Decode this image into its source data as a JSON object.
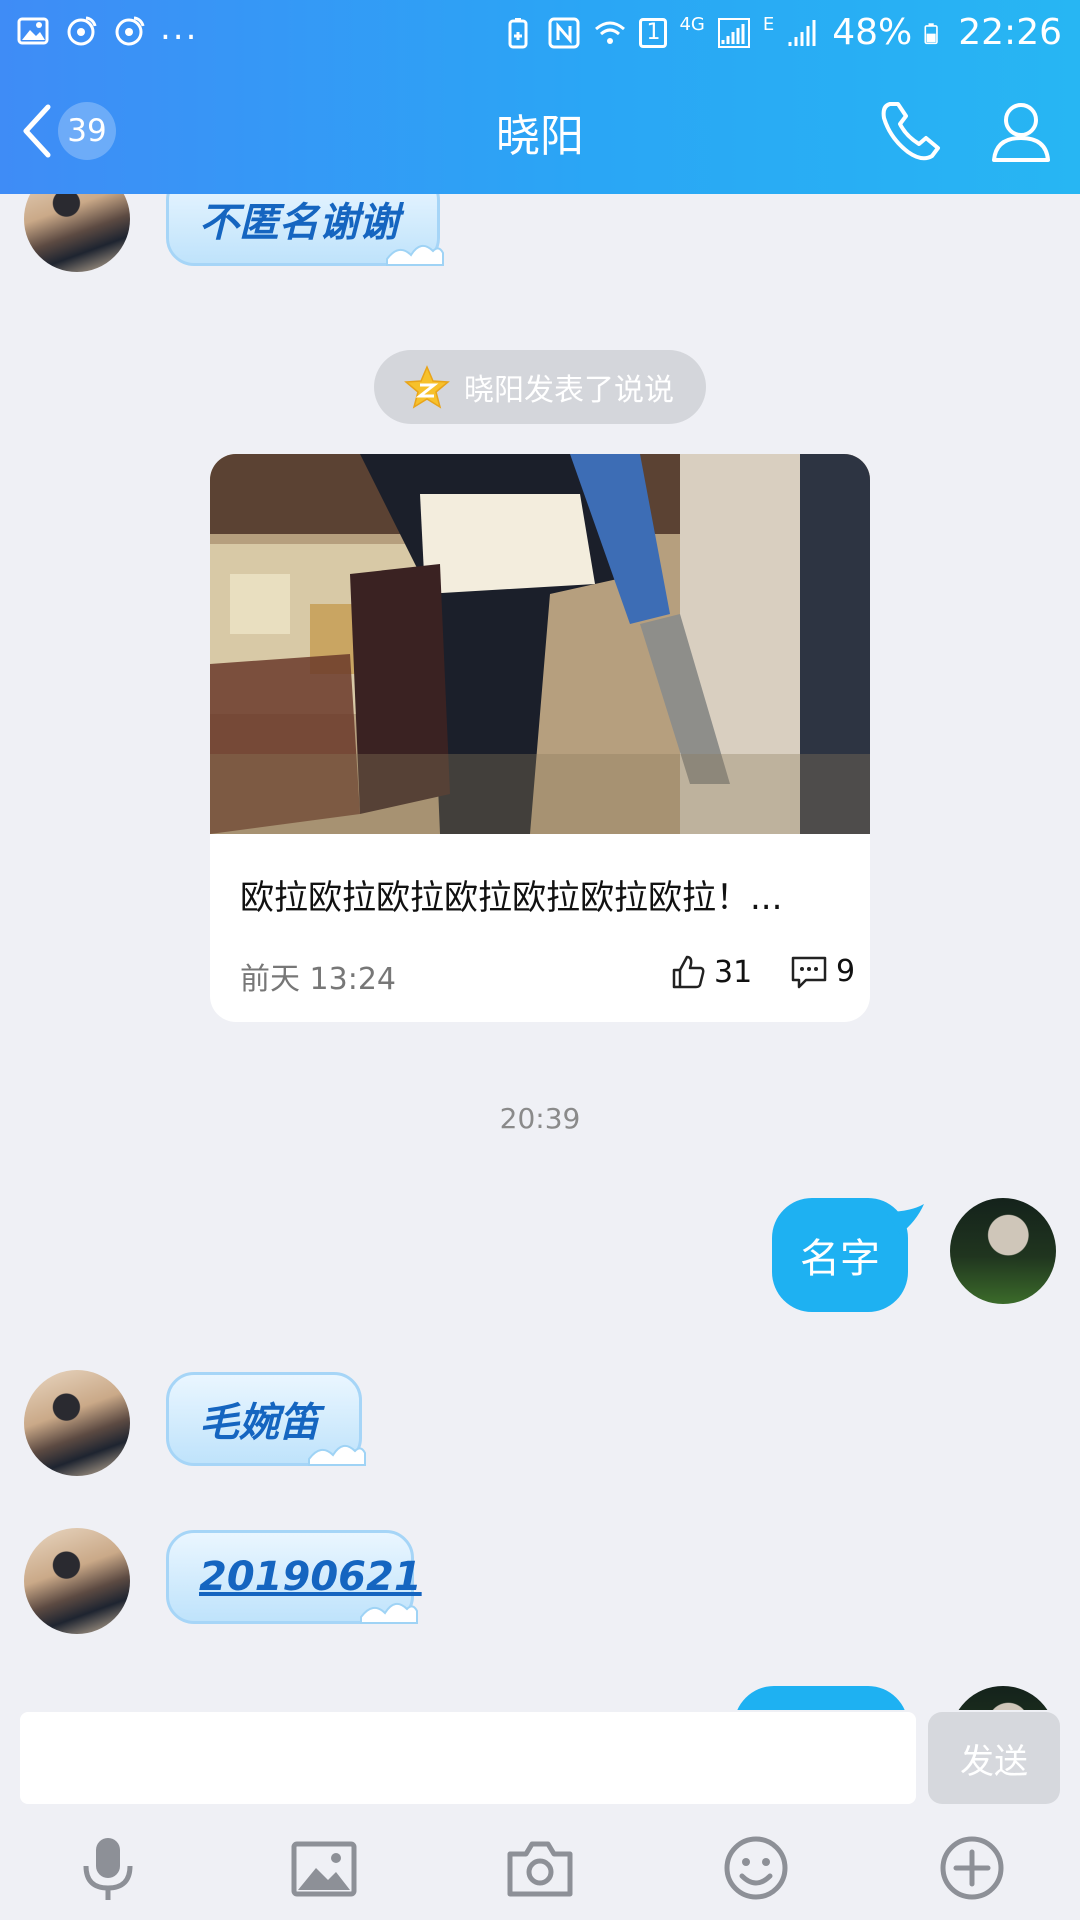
{
  "status_bar": {
    "battery": "48%",
    "time": "22:26",
    "sim_badge": "1",
    "network": "4G",
    "network2": "E",
    "icons": [
      "gallery-icon",
      "weibo-icon",
      "weibo-icon",
      "more-dots",
      "battery-saver-icon",
      "nfc-icon",
      "wifi-icon",
      "signal-icon",
      "signal-icon",
      "battery-icon"
    ]
  },
  "header": {
    "back_count": "39",
    "title": "晓阳",
    "icons": [
      "back-chevron-icon",
      "phone-icon",
      "profile-icon"
    ]
  },
  "messages": {
    "m1_text": "不匿名谢谢",
    "notice_text": "晓阳发表了说说",
    "post": {
      "text": "欧拉欧拉欧拉欧拉欧拉欧拉欧拉！...",
      "time": "前天 13:24",
      "likes": "31",
      "comments": "9"
    },
    "timestamp": "20:39",
    "m2_text": "名字",
    "m3_text": "毛婉笛",
    "m4_text": "20190621"
  },
  "input": {
    "value": "",
    "send_label": "发送",
    "toolbar_icons": [
      "microphone-icon",
      "image-icon",
      "camera-icon",
      "emoji-icon",
      "plus-icon"
    ]
  },
  "colors": {
    "header_gradient_start": "#3f8cf6",
    "header_gradient_end": "#27b6f3",
    "my_bubble": "#1eb1f2",
    "their_bubble_text": "#1565c0",
    "background": "#eff0f5"
  }
}
